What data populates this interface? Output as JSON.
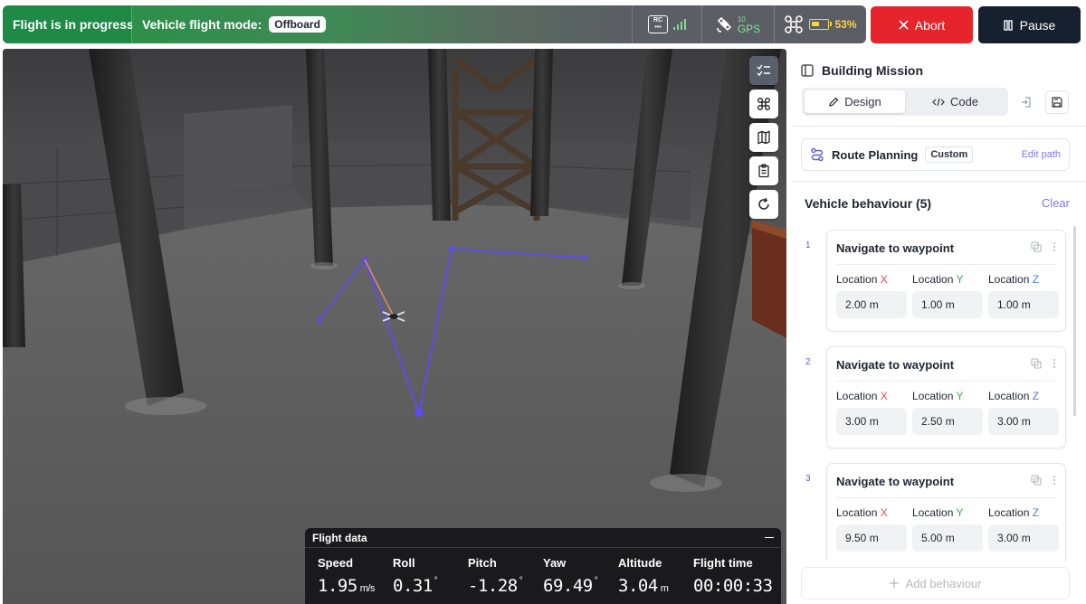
{
  "status": {
    "progress": "Flight is in progress",
    "mode_label": "Vehicle flight mode:",
    "mode_value": "Offboard",
    "rc_label_top": "RC",
    "rc_label_bottom": "•••",
    "gps_count": "10",
    "gps_label": "GPS",
    "battery_percent": "53%",
    "battery_level": 0.53
  },
  "actions": {
    "abort_label": "Abort",
    "pause_label": "Pause"
  },
  "viewport": {
    "tools": [
      "checklist-icon",
      "drone-icon",
      "map-icon",
      "clipboard-icon",
      "refresh-icon"
    ]
  },
  "flight_data": {
    "title": "Flight data",
    "items": [
      {
        "label": "Speed",
        "value": "1.95",
        "unit": "m/s"
      },
      {
        "label": "Roll",
        "value": "0.31",
        "unit": "°"
      },
      {
        "label": "Pitch",
        "value": "-1.28",
        "unit": "°"
      },
      {
        "label": "Yaw",
        "value": "69.49",
        "unit": "°"
      },
      {
        "label": "Altitude",
        "value": "3.04",
        "unit": "m"
      },
      {
        "label": "Flight time",
        "value": "00:00:33",
        "unit": ""
      }
    ]
  },
  "panel": {
    "mission_title": "Building Mission",
    "tabs": [
      {
        "label": "Design",
        "active": true
      },
      {
        "label": "Code",
        "active": false
      }
    ],
    "route": {
      "label": "Route Planning",
      "badge": "Custom",
      "edit": "Edit path"
    },
    "behaviours_title": "Vehicle behaviour (5)",
    "clear_label": "Clear",
    "loc_x": "Location",
    "axis_x": "X",
    "axis_y": "Y",
    "axis_z": "Z",
    "behaviours": [
      {
        "index": "1",
        "title": "Navigate to waypoint",
        "x": "2.00 m",
        "y": "1.00 m",
        "z": "1.00 m"
      },
      {
        "index": "2",
        "title": "Navigate to waypoint",
        "x": "3.00 m",
        "y": "2.50 m",
        "z": "3.00 m"
      },
      {
        "index": "3",
        "title": "Navigate to waypoint",
        "x": "9.50 m",
        "y": "5.00 m",
        "z": "3.00 m"
      }
    ],
    "add_label": "Add behaviour"
  },
  "colors": {
    "progress_green": "#1f8a45",
    "abort_red": "#e5242b",
    "pause_navy": "#17202f",
    "path_purple": "#5b4ee8",
    "link_purple": "#7d78f0",
    "battery_yellow": "#ffd43b"
  }
}
